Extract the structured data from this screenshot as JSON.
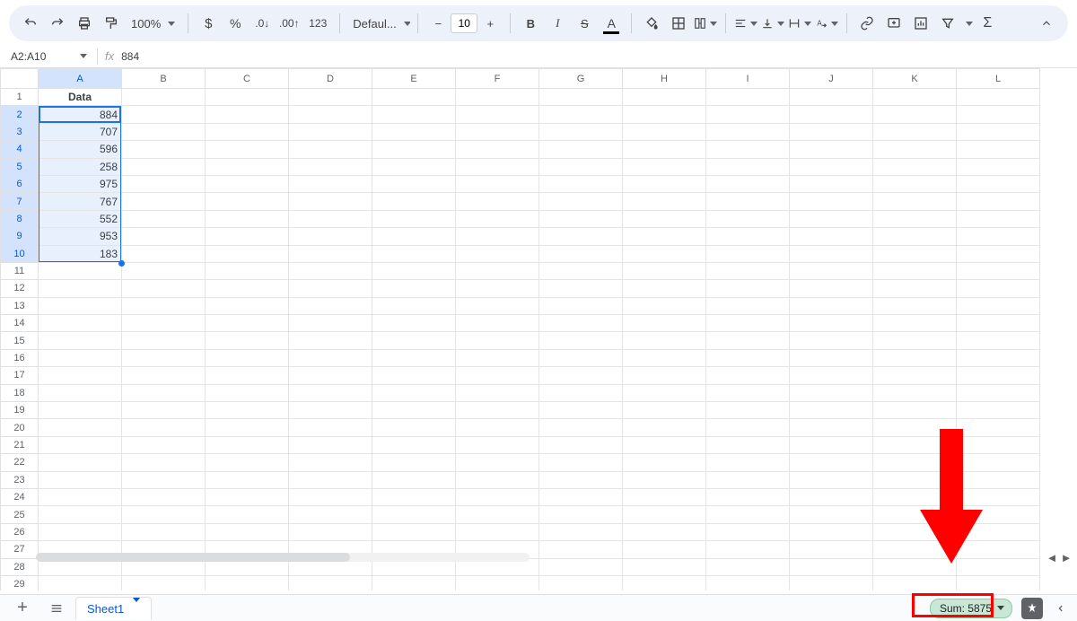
{
  "toolbar": {
    "zoom": "100%",
    "font": "Defaul...",
    "fontsize": "10"
  },
  "namebox": "A2:A10",
  "formula_value": "884",
  "columns": [
    "A",
    "B",
    "C",
    "D",
    "E",
    "F",
    "G",
    "H",
    "I",
    "J",
    "K",
    "L"
  ],
  "rows": 29,
  "selected_col": "A",
  "selected_rows_from": 2,
  "selected_rows_to": 10,
  "data": {
    "header": "Data",
    "values": [
      884,
      707,
      596,
      258,
      975,
      767,
      552,
      953,
      183
    ]
  },
  "sheet_tab": "Sheet1",
  "sum_chip": "Sum: 5875"
}
